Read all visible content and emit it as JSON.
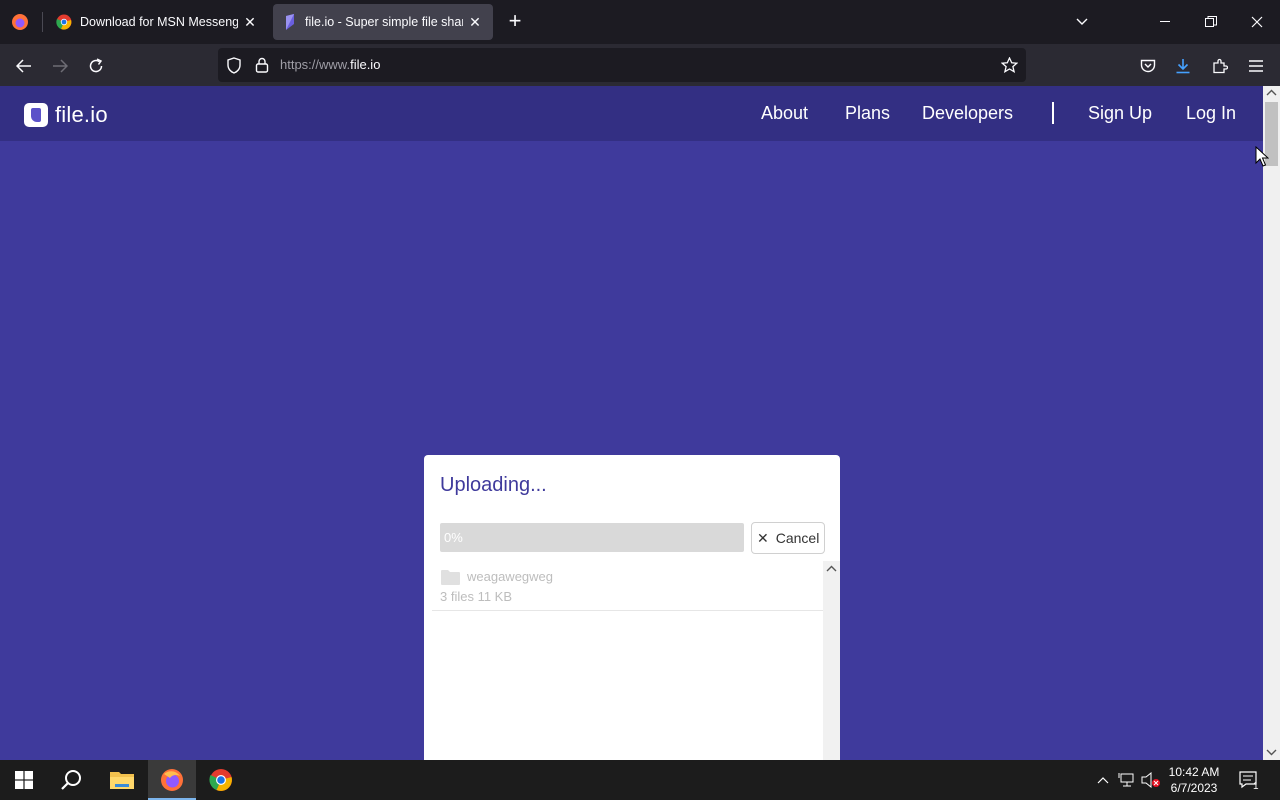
{
  "browser": {
    "tabs": [
      {
        "title": "Download for MSN Messenger",
        "active": false
      },
      {
        "title": "file.io - Super simple file sharing",
        "active": true
      }
    ],
    "url_prefix": "https://www.",
    "url_domain": "file.io"
  },
  "site": {
    "logo_text": "file.io",
    "nav": {
      "about": "About",
      "plans": "Plans",
      "developers": "Developers",
      "signup": "Sign Up",
      "login": "Log In"
    },
    "brand_color": "#3f3a9c",
    "header_color": "#332f83"
  },
  "upload": {
    "title": "Uploading...",
    "progress_percent": 0,
    "progress_label": "0%",
    "cancel_label": "Cancel",
    "item": {
      "name": "weagawegweg",
      "meta": "3 files 11 KB",
      "icon": "folder-icon"
    }
  },
  "taskbar": {
    "time": "10:42 AM",
    "date": "6/7/2023",
    "notification_count": "1"
  }
}
